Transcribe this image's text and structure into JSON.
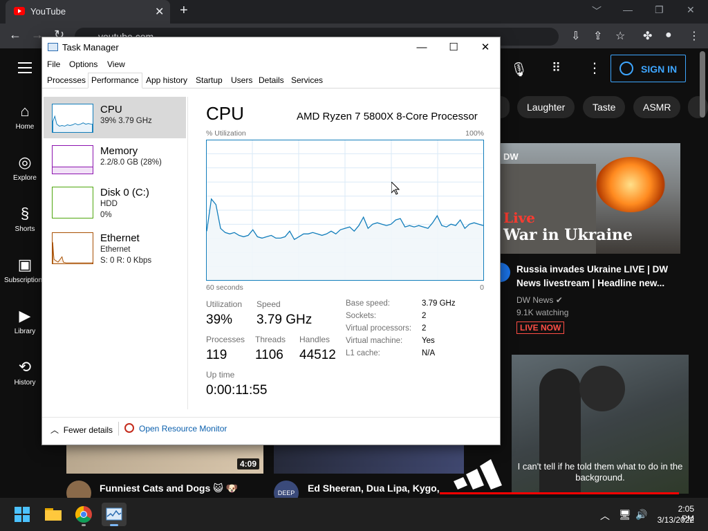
{
  "browser": {
    "tab_title": "YouTube",
    "tab_close": "✕",
    "new_tab": "+",
    "url": "youtube.com",
    "window_controls": [
      "﹀",
      "—",
      "❐",
      "✕"
    ]
  },
  "youtube": {
    "signin_label": "SIGN IN",
    "sidebar": [
      {
        "label": "Home",
        "icon": "home-icon"
      },
      {
        "label": "Explore",
        "icon": "compass-icon"
      },
      {
        "label": "Shorts",
        "icon": "shorts-icon"
      },
      {
        "label": "Subscriptions",
        "icon": "subscriptions-icon"
      },
      {
        "label": "Library",
        "icon": "library-icon"
      },
      {
        "label": "History",
        "icon": "history-icon"
      }
    ],
    "chips": [
      "Laughter",
      "Taste",
      "ASMR"
    ],
    "featured_video": {
      "thumb_live": "Live",
      "thumb_title": "War in Ukraine",
      "thumb_logo": "DW",
      "title": "Russia invades Ukraine LIVE | DW News livestream | Headline new...",
      "channel": "DW News",
      "watching": "9.1K watching",
      "badge": "LIVE NOW"
    },
    "second_thumb_caption": "I can't tell if he told them what to do in the background.",
    "bottom_videos": [
      {
        "title": "Funniest Cats and Dogs 😺 🐶",
        "duration": "4:09"
      },
      {
        "title": "Ed Sheeran, Dua Lipa, Kygo, Av",
        "avatar_text": "DEEP"
      }
    ],
    "adidas_text": "adidas"
  },
  "task_manager": {
    "title": "Task Manager",
    "controls": [
      "—",
      "☐",
      "✕"
    ],
    "menu": [
      "File",
      "Options",
      "View"
    ],
    "tabs": [
      "Processes",
      "Performance",
      "App history",
      "Startup",
      "Users",
      "Details",
      "Services"
    ],
    "active_tab": "Performance",
    "sidebar": [
      {
        "name": "CPU",
        "sub1": "39% 3.79 GHz",
        "sub2": "",
        "color": "#117dbb"
      },
      {
        "name": "Memory",
        "sub1": "2.2/8.0 GB (28%)",
        "sub2": "",
        "color": "#8b12ae"
      },
      {
        "name": "Disk 0 (C:)",
        "sub1": "HDD",
        "sub2": "0%",
        "color": "#4da60c"
      },
      {
        "name": "Ethernet",
        "sub1": "Ethernet",
        "sub2": "S: 0 R: 0 Kbps",
        "color": "#a74f01"
      }
    ],
    "cpu": {
      "heading": "CPU",
      "model": "AMD Ryzen 7 5800X 8-Core Processor",
      "y_label": "% Utilization",
      "y_max_label": "100%",
      "x_left_label": "60 seconds",
      "x_right_label": "0",
      "utilization_history": [
        35,
        58,
        54,
        37,
        34,
        33,
        34,
        32,
        31,
        32,
        36,
        31,
        30,
        31,
        32,
        30,
        30,
        31,
        35,
        29,
        31,
        33,
        33,
        34,
        33,
        32,
        33,
        35,
        33,
        36,
        37,
        38,
        35,
        39,
        45,
        37,
        40,
        41,
        40,
        39,
        40,
        43,
        44,
        38,
        39,
        38,
        39,
        38,
        37,
        41,
        46,
        39,
        38,
        40,
        39,
        43,
        37,
        40,
        41,
        40,
        39
      ],
      "stats": [
        {
          "label": "Utilization",
          "value": "39%"
        },
        {
          "label": "Speed",
          "value": "3.79 GHz"
        },
        {
          "label": "Processes",
          "value": "119"
        },
        {
          "label": "Threads",
          "value": "1106"
        },
        {
          "label": "Handles",
          "value": "44512"
        },
        {
          "label": "Up time",
          "value": "0:00:11:55"
        }
      ],
      "specs": [
        {
          "label": "Base speed:",
          "value": "3.79 GHz"
        },
        {
          "label": "Sockets:",
          "value": "2"
        },
        {
          "label": "Virtual processors:",
          "value": "2"
        },
        {
          "label": "Virtual machine:",
          "value": "Yes"
        },
        {
          "label": "L1 cache:",
          "value": "N/A"
        }
      ]
    },
    "fewer_details": "Fewer details",
    "open_resource_monitor": "Open Resource Monitor"
  },
  "taskbar": {
    "time": "2:05 PM",
    "date": "3/13/2022"
  }
}
